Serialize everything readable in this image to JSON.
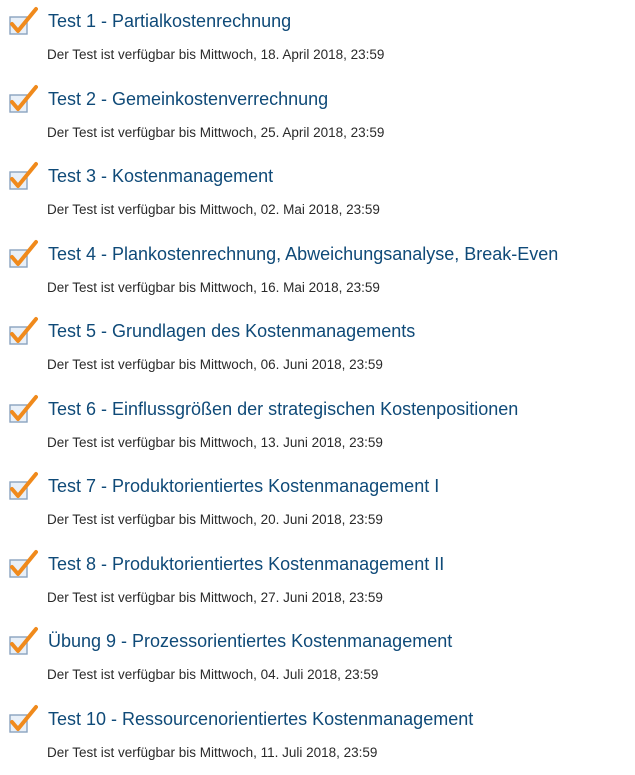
{
  "quizzes": [
    {
      "title": "Test 1 - Partialkostenrechnung",
      "availability": "Der Test ist verfügbar bis Mittwoch, 18. April 2018, 23:59",
      "icon": "quiz-check-icon"
    },
    {
      "title": "Test 2 - Gemeinkostenverrechnung",
      "availability": "Der Test ist verfügbar bis Mittwoch, 25. April 2018, 23:59",
      "icon": "quiz-check-icon"
    },
    {
      "title": "Test 3 - Kostenmanagement",
      "availability": "Der Test ist verfügbar bis Mittwoch, 02. Mai 2018, 23:59",
      "icon": "quiz-check-icon"
    },
    {
      "title": "Test 4 - Plankostenrechnung, Abweichungsanalyse, Break-Even",
      "availability": "Der Test ist verfügbar bis Mittwoch, 16. Mai 2018, 23:59",
      "icon": "quiz-check-icon"
    },
    {
      "title": "Test 5 - Grundlagen des Kostenmanagements",
      "availability": "Der Test ist verfügbar bis Mittwoch, 06. Juni 2018, 23:59",
      "icon": "quiz-check-icon"
    },
    {
      "title": "Test 6 - Einflussgrößen der strategischen Kostenpositionen",
      "availability": "Der Test ist verfügbar bis Mittwoch, 13. Juni 2018, 23:59",
      "icon": "quiz-check-icon"
    },
    {
      "title": "Test 7 - Produktorientiertes Kostenmanagement I",
      "availability": "Der Test ist verfügbar bis Mittwoch, 20. Juni 2018, 23:59",
      "icon": "quiz-check-icon"
    },
    {
      "title": "Test 8 - Produktorientiertes Kostenmanagement II",
      "availability": "Der Test ist verfügbar bis Mittwoch, 27. Juni 2018, 23:59",
      "icon": "quiz-check-icon"
    },
    {
      "title": "Übung 9 - Prozessorientiertes Kostenmanagement",
      "availability": "Der Test ist verfügbar bis Mittwoch, 04. Juli 2018, 23:59",
      "icon": "quiz-check-icon"
    },
    {
      "title": "Test 10 - Ressourcenorientiertes Kostenmanagement",
      "availability": "Der Test ist verfügbar bis Mittwoch, 11. Juli 2018, 23:59",
      "icon": "quiz-check-icon"
    }
  ],
  "colors": {
    "link": "#0f4a78",
    "info_text": "#2a2a2a",
    "check": "#f08a1c",
    "box_fill": "#e9f0f8",
    "box_stroke": "#8aa3bf"
  }
}
